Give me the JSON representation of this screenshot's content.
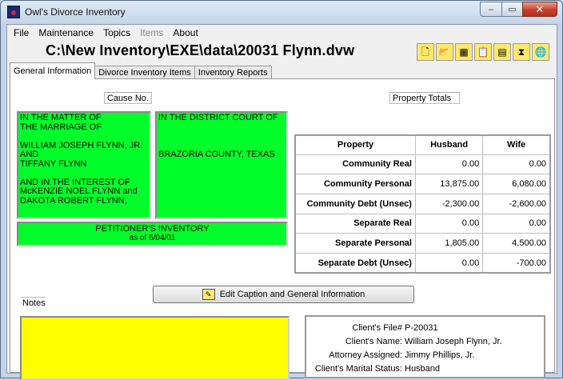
{
  "window": {
    "title": "Owl's Divorce Inventory",
    "min_glyph": "–",
    "max_glyph": "▭",
    "close_glyph": "✕"
  },
  "menu": [
    "File",
    "Maintenance",
    "Topics",
    "Items",
    "About"
  ],
  "file_path": "C:\\New Inventory\\EXE\\data\\20031 Flynn.dvw",
  "toolbar": [
    {
      "icon": "new-document-icon",
      "glyph": "🗋"
    },
    {
      "icon": "open-folder-icon",
      "glyph": "📂"
    },
    {
      "icon": "calendar-icon",
      "glyph": "▦"
    },
    {
      "icon": "clipboard-icon",
      "glyph": "📋"
    },
    {
      "icon": "calculator-icon",
      "glyph": "▤"
    },
    {
      "icon": "hourglass-icon",
      "glyph": "⧗"
    },
    {
      "icon": "globe-icon",
      "glyph": "🌐"
    }
  ],
  "tabs": [
    "General Information",
    "Divorce Inventory Items",
    "Inventory Reports"
  ],
  "cause_no_label": "Cause No.",
  "property_totals_label": "Property Totals",
  "caption_left": "IN THE MATTER OF\nTHE MARRIAGE OF\n\nWILLIAM JOSEPH FLYNN, JR.\nAND\nTIFFANY FLYNN\n\nAND IN THE INTEREST OF\nMcKENZIE NOEL FLYNN and\nDAKOTA ROBERT FLYNN,",
  "caption_right": "IN THE DISTRICT COURT OF\n\n\n\nBRAZORIA COUNTY, TEXAS",
  "inventory_title": "PETITIONER'S INVENTORY",
  "inventory_date": "as of 6/04/01",
  "totals": {
    "headers": [
      "Property",
      "Husband",
      "Wife"
    ],
    "rows": [
      {
        "label": "Community Real",
        "husband": "0.00",
        "wife": "0.00"
      },
      {
        "label": "Community Personal",
        "husband": "13,875.00",
        "wife": "6,080.00"
      },
      {
        "label": "Community Debt (Unsec)",
        "husband": "-2,300.00",
        "wife": "-2,600.00"
      },
      {
        "label": "Separate Real",
        "husband": "0.00",
        "wife": "0.00"
      },
      {
        "label": "Separate Personal",
        "husband": "1,805.00",
        "wife": "4,500.00"
      },
      {
        "label": "Separate Debt (Unsec)",
        "husband": "0.00",
        "wife": "-700.00"
      }
    ]
  },
  "edit_button_label": "Edit Caption and General Information",
  "notes_label": "Notes",
  "client": {
    "file_label": "Client's File#",
    "file_value": "P-20031",
    "name_label": "Client's Name:",
    "name_value": "William Joseph Flynn, Jr.",
    "attorney_label": "Attorney Assigned:",
    "attorney_value": "Jimmy Phillips, Jr.",
    "status_label": "Client's Marital Status:",
    "status_value": "Husband"
  },
  "colors": {
    "caption_green": "#00ff2a",
    "notes_yellow": "#ffff00",
    "close_red": "#c8402a"
  }
}
